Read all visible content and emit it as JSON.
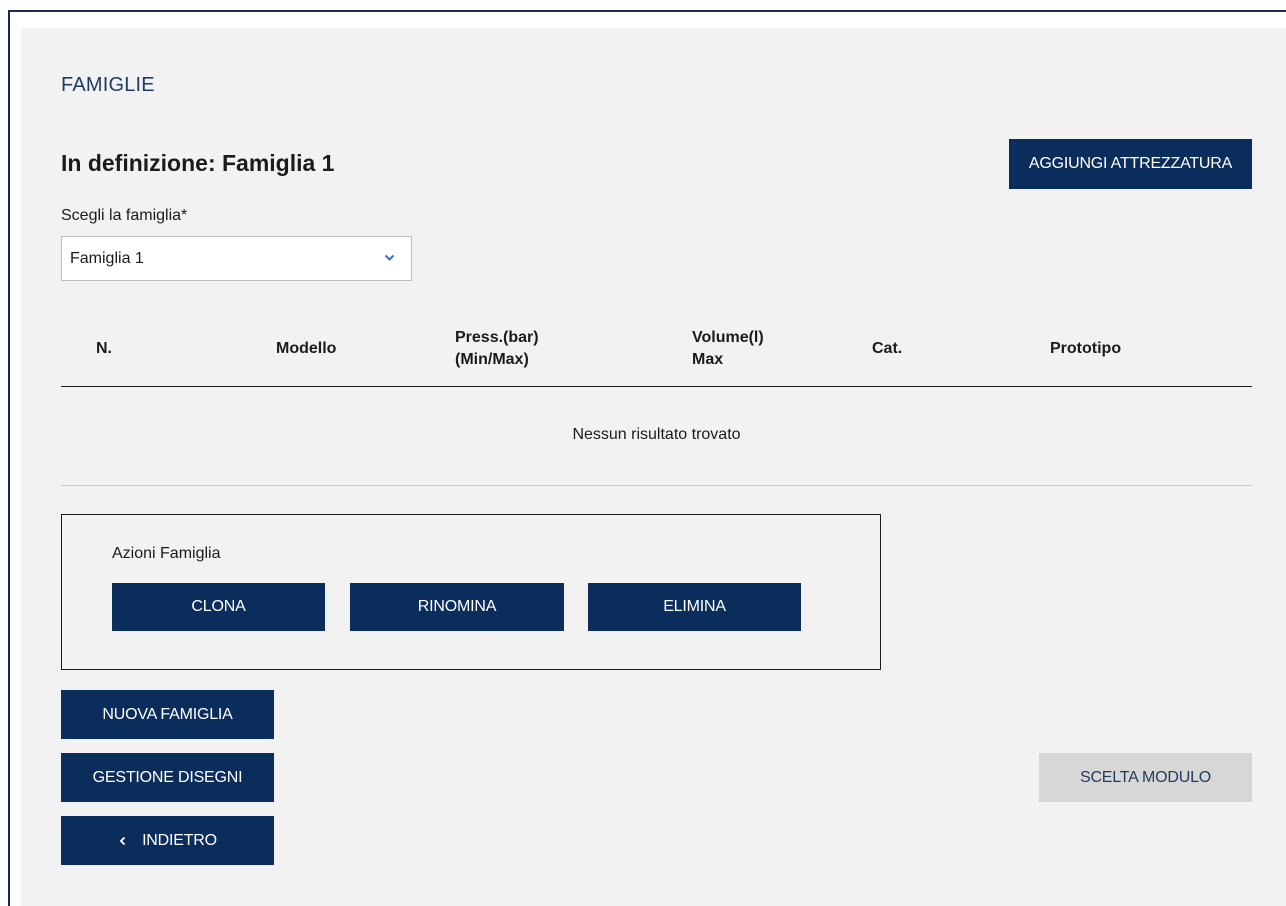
{
  "header": {
    "section_title": "FAMIGLIE",
    "page_title": "In definizione: Famiglia 1",
    "add_equipment_label": "AGGIUNGI ATTREZZATURA"
  },
  "family_select": {
    "label": "Scegli la famiglia*",
    "selected_value": "Famiglia 1",
    "icon": "chevron-down-icon"
  },
  "table": {
    "columns": [
      [
        "N."
      ],
      [
        "Modello"
      ],
      [
        "Press.(bar)",
        "(Min/Max)"
      ],
      [
        "Volume(l)",
        "Max"
      ],
      [
        "Cat."
      ],
      [
        "Prototipo"
      ]
    ],
    "empty_message": "Nessun risultato trovato"
  },
  "family_actions": {
    "title": "Azioni Famiglia",
    "clone_label": "CLONA",
    "rename_label": "RINOMINA",
    "delete_label": "ELIMINA"
  },
  "footer": {
    "new_family_label": "NUOVA FAMIGLIA",
    "manage_drawings_label": "GESTIONE DISEGNI",
    "back_label": "INDIETRO",
    "back_icon": "chevron-left-icon",
    "choose_module_label": "SCELTA MODULO"
  },
  "colors": {
    "primary": "#0b2d5b",
    "panel_bg": "#f2f2f2",
    "disabled_bg": "#d7d7d7",
    "title_blue": "#1f3a5f",
    "chevron_blue": "#2f6fd6"
  }
}
